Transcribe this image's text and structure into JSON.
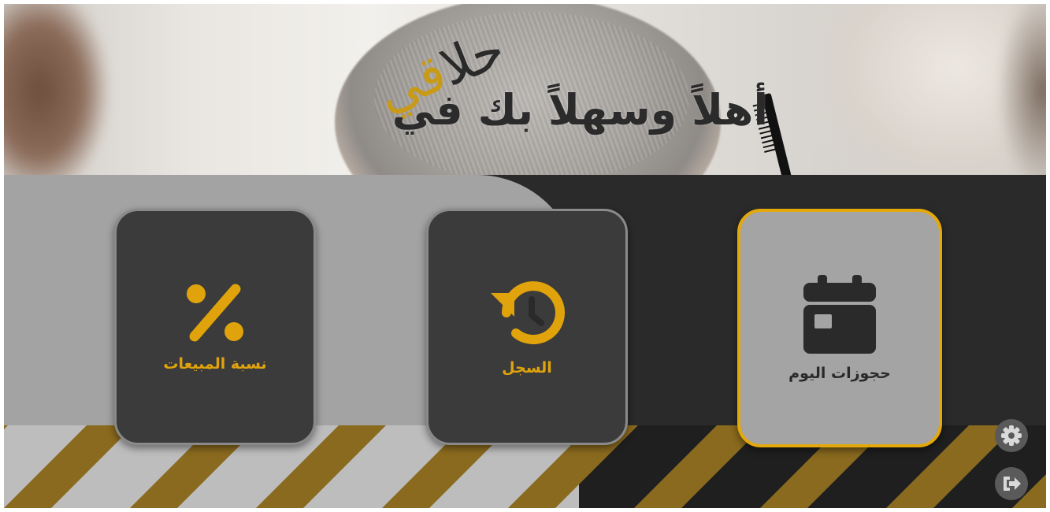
{
  "header": {
    "welcome_text": "أهلاً وسهلاً بك في",
    "app_name_dark": "حلا",
    "app_name_gold": "قي"
  },
  "tiles": [
    {
      "label": "نسبة المبيعات",
      "icon": "percent-icon"
    },
    {
      "label": "السجل",
      "icon": "history-icon"
    },
    {
      "label": "حجوزات اليوم",
      "icon": "calendar-icon",
      "active": true
    }
  ],
  "side_buttons": [
    {
      "icon": "gear-icon"
    },
    {
      "icon": "logout-icon"
    }
  ],
  "colors": {
    "accent": "#e3a80c",
    "dark": "#2a2a2a",
    "tile_dark": "#3b3b3b",
    "tile_active": "#a4a4a4",
    "panel_grey": "#a3a3a3"
  }
}
